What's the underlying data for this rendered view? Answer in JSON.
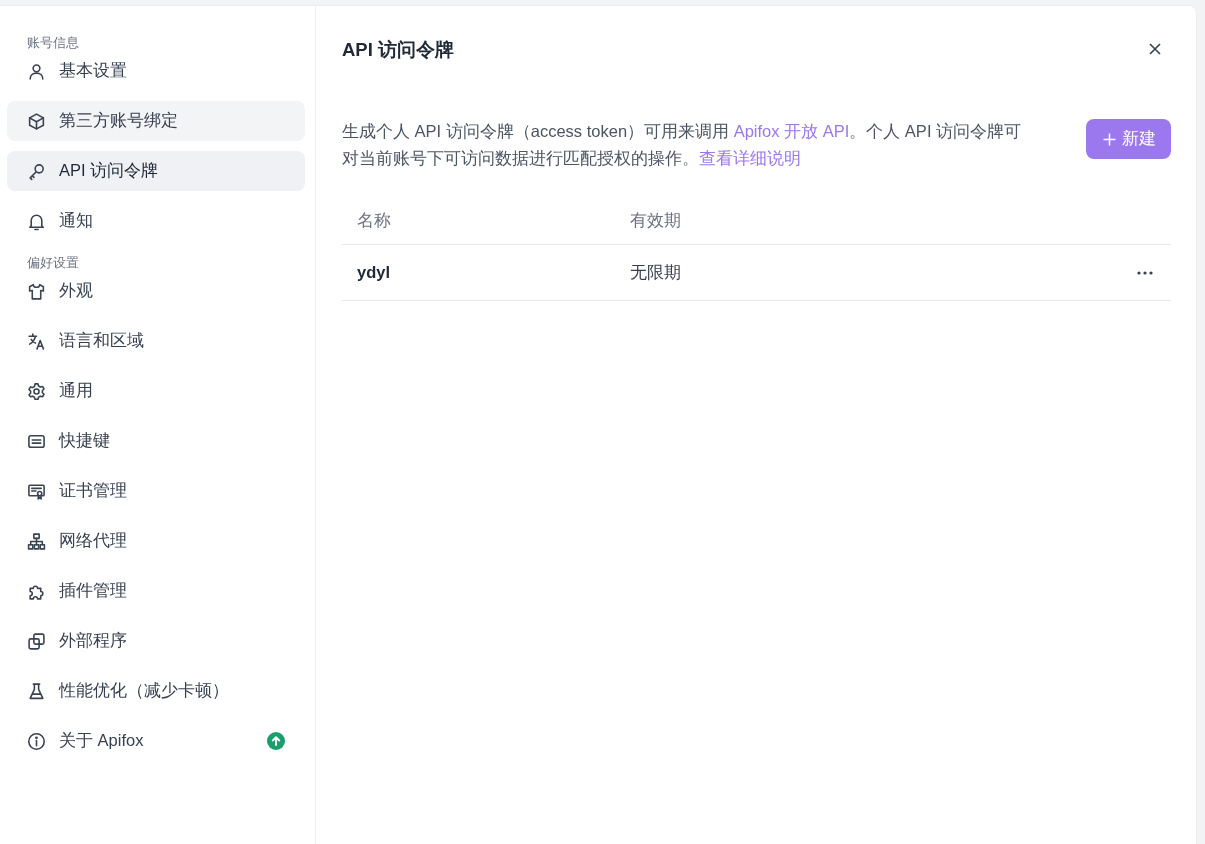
{
  "sidebar": {
    "sections": [
      {
        "title": "账号信息",
        "items": [
          {
            "label": "基本设置",
            "selected": false,
            "hovered": false
          },
          {
            "label": "第三方账号绑定",
            "selected": false,
            "hovered": true
          },
          {
            "label": "API 访问令牌",
            "selected": true,
            "hovered": false
          },
          {
            "label": "通知",
            "selected": false,
            "hovered": false
          }
        ]
      },
      {
        "title": "偏好设置",
        "items": [
          {
            "label": "外观",
            "selected": false,
            "hovered": false
          },
          {
            "label": "语言和区域",
            "selected": false,
            "hovered": false
          },
          {
            "label": "通用",
            "selected": false,
            "hovered": false
          },
          {
            "label": "快捷键",
            "selected": false,
            "hovered": false
          },
          {
            "label": "证书管理",
            "selected": false,
            "hovered": false
          },
          {
            "label": "网络代理",
            "selected": false,
            "hovered": false
          },
          {
            "label": "插件管理",
            "selected": false,
            "hovered": false
          },
          {
            "label": "外部程序",
            "selected": false,
            "hovered": false
          },
          {
            "label": "性能优化（减少卡顿）",
            "selected": false,
            "hovered": false
          },
          {
            "label": "关于 Apifox",
            "selected": false,
            "hovered": false,
            "update_available": true
          }
        ]
      }
    ]
  },
  "panel": {
    "title": "API 访问令牌",
    "description": "生成个人 API 访问令牌（access token）可用来调用 ",
    "description_link": "Apifox 开放 API",
    "description_rest": "。个人 API 访问令牌可对当前账号下可访问数据进行匹配授权的操作。",
    "details_link": "查看详细说明",
    "new_button": "新建",
    "table": {
      "columns": [
        "名称",
        "有效期"
      ],
      "rows": [
        {
          "name": "ydyl",
          "expiry": "无限期"
        }
      ]
    }
  }
}
